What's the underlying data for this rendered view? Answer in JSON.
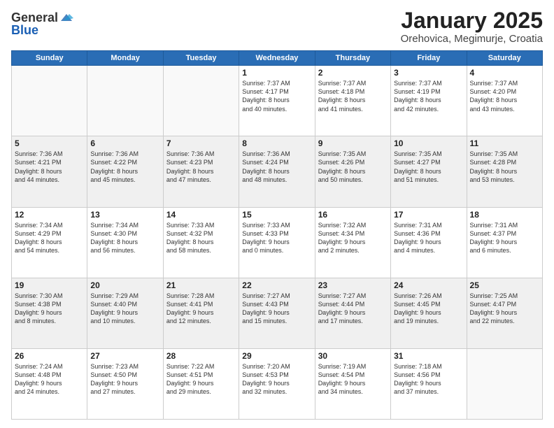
{
  "header": {
    "logo_general": "General",
    "logo_blue": "Blue",
    "title": "January 2025",
    "subtitle": "Orehovica, Megimurje, Croatia"
  },
  "weekdays": [
    "Sunday",
    "Monday",
    "Tuesday",
    "Wednesday",
    "Thursday",
    "Friday",
    "Saturday"
  ],
  "rows": [
    {
      "cells": [
        {
          "day": "",
          "empty": true
        },
        {
          "day": "",
          "empty": true
        },
        {
          "day": "",
          "empty": true
        },
        {
          "day": "1",
          "line1": "Sunrise: 7:37 AM",
          "line2": "Sunset: 4:17 PM",
          "line3": "Daylight: 8 hours",
          "line4": "and 40 minutes."
        },
        {
          "day": "2",
          "line1": "Sunrise: 7:37 AM",
          "line2": "Sunset: 4:18 PM",
          "line3": "Daylight: 8 hours",
          "line4": "and 41 minutes."
        },
        {
          "day": "3",
          "line1": "Sunrise: 7:37 AM",
          "line2": "Sunset: 4:19 PM",
          "line3": "Daylight: 8 hours",
          "line4": "and 42 minutes."
        },
        {
          "day": "4",
          "line1": "Sunrise: 7:37 AM",
          "line2": "Sunset: 4:20 PM",
          "line3": "Daylight: 8 hours",
          "line4": "and 43 minutes."
        }
      ]
    },
    {
      "cells": [
        {
          "day": "5",
          "line1": "Sunrise: 7:36 AM",
          "line2": "Sunset: 4:21 PM",
          "line3": "Daylight: 8 hours",
          "line4": "and 44 minutes."
        },
        {
          "day": "6",
          "line1": "Sunrise: 7:36 AM",
          "line2": "Sunset: 4:22 PM",
          "line3": "Daylight: 8 hours",
          "line4": "and 45 minutes."
        },
        {
          "day": "7",
          "line1": "Sunrise: 7:36 AM",
          "line2": "Sunset: 4:23 PM",
          "line3": "Daylight: 8 hours",
          "line4": "and 47 minutes."
        },
        {
          "day": "8",
          "line1": "Sunrise: 7:36 AM",
          "line2": "Sunset: 4:24 PM",
          "line3": "Daylight: 8 hours",
          "line4": "and 48 minutes."
        },
        {
          "day": "9",
          "line1": "Sunrise: 7:35 AM",
          "line2": "Sunset: 4:26 PM",
          "line3": "Daylight: 8 hours",
          "line4": "and 50 minutes."
        },
        {
          "day": "10",
          "line1": "Sunrise: 7:35 AM",
          "line2": "Sunset: 4:27 PM",
          "line3": "Daylight: 8 hours",
          "line4": "and 51 minutes."
        },
        {
          "day": "11",
          "line1": "Sunrise: 7:35 AM",
          "line2": "Sunset: 4:28 PM",
          "line3": "Daylight: 8 hours",
          "line4": "and 53 minutes."
        }
      ]
    },
    {
      "cells": [
        {
          "day": "12",
          "line1": "Sunrise: 7:34 AM",
          "line2": "Sunset: 4:29 PM",
          "line3": "Daylight: 8 hours",
          "line4": "and 54 minutes."
        },
        {
          "day": "13",
          "line1": "Sunrise: 7:34 AM",
          "line2": "Sunset: 4:30 PM",
          "line3": "Daylight: 8 hours",
          "line4": "and 56 minutes."
        },
        {
          "day": "14",
          "line1": "Sunrise: 7:33 AM",
          "line2": "Sunset: 4:32 PM",
          "line3": "Daylight: 8 hours",
          "line4": "and 58 minutes."
        },
        {
          "day": "15",
          "line1": "Sunrise: 7:33 AM",
          "line2": "Sunset: 4:33 PM",
          "line3": "Daylight: 9 hours",
          "line4": "and 0 minutes."
        },
        {
          "day": "16",
          "line1": "Sunrise: 7:32 AM",
          "line2": "Sunset: 4:34 PM",
          "line3": "Daylight: 9 hours",
          "line4": "and 2 minutes."
        },
        {
          "day": "17",
          "line1": "Sunrise: 7:31 AM",
          "line2": "Sunset: 4:36 PM",
          "line3": "Daylight: 9 hours",
          "line4": "and 4 minutes."
        },
        {
          "day": "18",
          "line1": "Sunrise: 7:31 AM",
          "line2": "Sunset: 4:37 PM",
          "line3": "Daylight: 9 hours",
          "line4": "and 6 minutes."
        }
      ]
    },
    {
      "cells": [
        {
          "day": "19",
          "line1": "Sunrise: 7:30 AM",
          "line2": "Sunset: 4:38 PM",
          "line3": "Daylight: 9 hours",
          "line4": "and 8 minutes."
        },
        {
          "day": "20",
          "line1": "Sunrise: 7:29 AM",
          "line2": "Sunset: 4:40 PM",
          "line3": "Daylight: 9 hours",
          "line4": "and 10 minutes."
        },
        {
          "day": "21",
          "line1": "Sunrise: 7:28 AM",
          "line2": "Sunset: 4:41 PM",
          "line3": "Daylight: 9 hours",
          "line4": "and 12 minutes."
        },
        {
          "day": "22",
          "line1": "Sunrise: 7:27 AM",
          "line2": "Sunset: 4:43 PM",
          "line3": "Daylight: 9 hours",
          "line4": "and 15 minutes."
        },
        {
          "day": "23",
          "line1": "Sunrise: 7:27 AM",
          "line2": "Sunset: 4:44 PM",
          "line3": "Daylight: 9 hours",
          "line4": "and 17 minutes."
        },
        {
          "day": "24",
          "line1": "Sunrise: 7:26 AM",
          "line2": "Sunset: 4:45 PM",
          "line3": "Daylight: 9 hours",
          "line4": "and 19 minutes."
        },
        {
          "day": "25",
          "line1": "Sunrise: 7:25 AM",
          "line2": "Sunset: 4:47 PM",
          "line3": "Daylight: 9 hours",
          "line4": "and 22 minutes."
        }
      ]
    },
    {
      "cells": [
        {
          "day": "26",
          "line1": "Sunrise: 7:24 AM",
          "line2": "Sunset: 4:48 PM",
          "line3": "Daylight: 9 hours",
          "line4": "and 24 minutes."
        },
        {
          "day": "27",
          "line1": "Sunrise: 7:23 AM",
          "line2": "Sunset: 4:50 PM",
          "line3": "Daylight: 9 hours",
          "line4": "and 27 minutes."
        },
        {
          "day": "28",
          "line1": "Sunrise: 7:22 AM",
          "line2": "Sunset: 4:51 PM",
          "line3": "Daylight: 9 hours",
          "line4": "and 29 minutes."
        },
        {
          "day": "29",
          "line1": "Sunrise: 7:20 AM",
          "line2": "Sunset: 4:53 PM",
          "line3": "Daylight: 9 hours",
          "line4": "and 32 minutes."
        },
        {
          "day": "30",
          "line1": "Sunrise: 7:19 AM",
          "line2": "Sunset: 4:54 PM",
          "line3": "Daylight: 9 hours",
          "line4": "and 34 minutes."
        },
        {
          "day": "31",
          "line1": "Sunrise: 7:18 AM",
          "line2": "Sunset: 4:56 PM",
          "line3": "Daylight: 9 hours",
          "line4": "and 37 minutes."
        },
        {
          "day": "",
          "empty": true
        }
      ]
    }
  ]
}
